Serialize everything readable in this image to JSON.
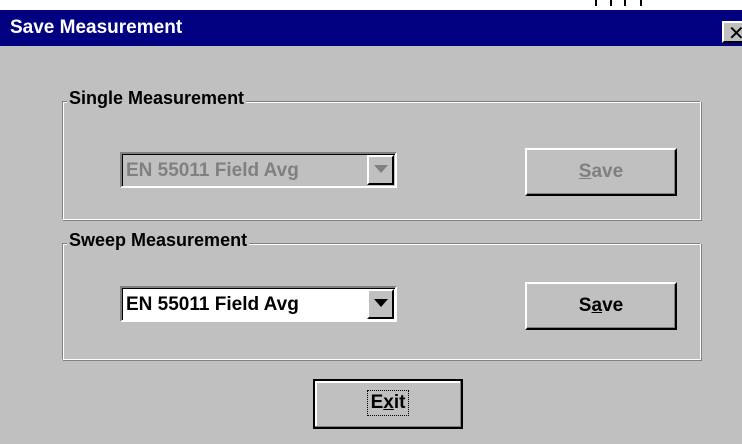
{
  "window": {
    "title": "Save Measurement",
    "close_symbol": "✕"
  },
  "single_measurement": {
    "label": "Single Measurement",
    "combo_value": "EN 55011 Field Avg",
    "enabled": false,
    "save_label_prefix": "",
    "save_label_underlined": "S",
    "save_label_suffix": "ave"
  },
  "sweep_measurement": {
    "label": "Sweep Measurement",
    "combo_value": "EN 55011 Field Avg",
    "enabled": true,
    "save_label_prefix": "S",
    "save_label_underlined": "a",
    "save_label_suffix": "ve"
  },
  "exit_button": {
    "label_prefix": "E",
    "label_underlined": "x",
    "label_suffix": "it"
  },
  "colors": {
    "titlebar": "#000080",
    "face": "#c0c0c0",
    "disabled_text": "#808080"
  }
}
